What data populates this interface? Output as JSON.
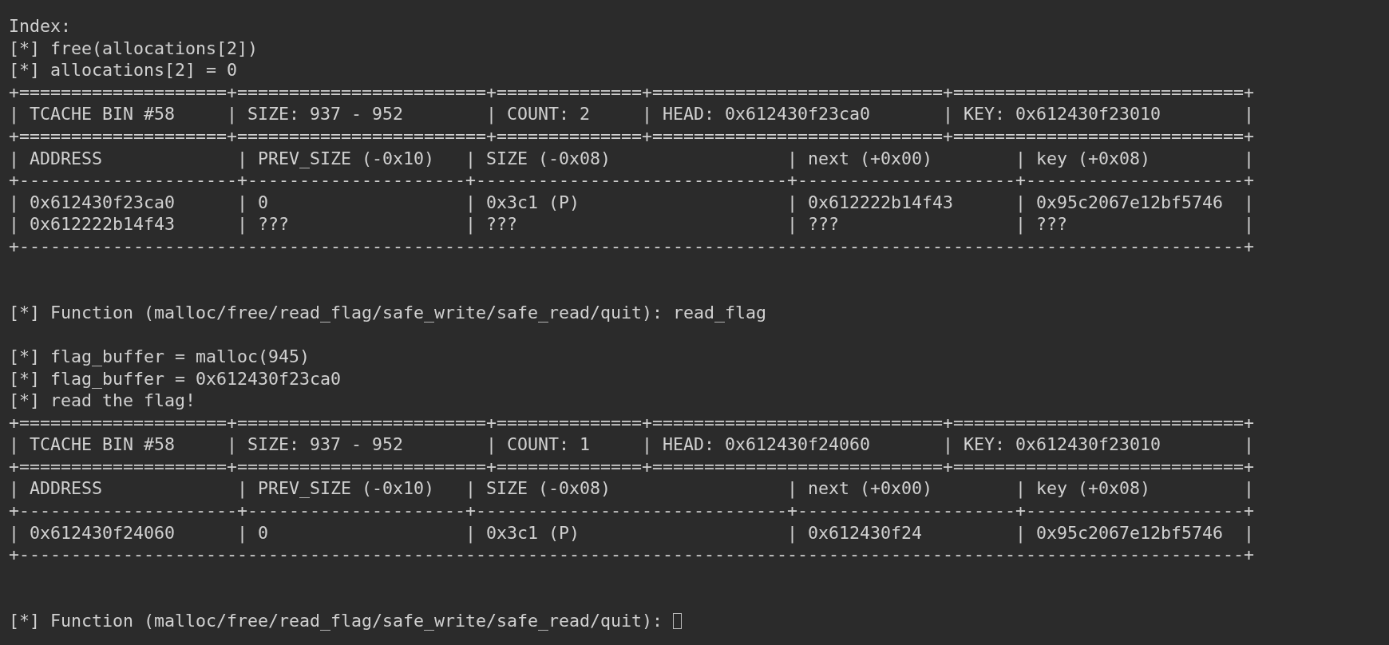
{
  "terminal": {
    "lines": [
      {
        "text": "Index:"
      },
      {
        "text": "[*] free(allocations[2])"
      },
      {
        "text": "[*] allocations[2] = 0"
      },
      {
        "text": "+====================+========================+==============+============================+============================+"
      },
      {
        "text": "| TCACHE BIN #58     | SIZE: 937 - 952        | COUNT: 2     | HEAD: 0x612430f23ca0       | KEY: 0x612430f23010        |"
      },
      {
        "text": "+====================+========================+==============+============================+============================+"
      },
      {
        "text": "| ADDRESS             | PREV_SIZE (-0x10)   | SIZE (-0x08)                 | next (+0x00)        | key (+0x08)         |"
      },
      {
        "text": "+---------------------+---------------------+------------------------------+---------------------+---------------------+"
      },
      {
        "text": "| 0x612430f23ca0      | 0                   | 0x3c1 (P)                    | 0x612222b14f43      | 0x95c2067e12bf5746  |"
      },
      {
        "text": "| 0x612222b14f43      | ???                 | ???                          | ???                 | ???                 |"
      },
      {
        "text": "+----------------------------------------------------------------------------------------------------------------------+"
      },
      {
        "kind": "blank"
      },
      {
        "kind": "blank"
      },
      {
        "text": "[*] Function (malloc/free/read_flag/safe_write/safe_read/quit): read_flag"
      },
      {
        "kind": "blank"
      },
      {
        "text": "[*] flag_buffer = malloc(945)"
      },
      {
        "text": "[*] flag_buffer = 0x612430f23ca0"
      },
      {
        "text": "[*] read the flag!"
      },
      {
        "text": "+====================+========================+==============+============================+============================+"
      },
      {
        "text": "| TCACHE BIN #58     | SIZE: 937 - 952        | COUNT: 1     | HEAD: 0x612430f24060       | KEY: 0x612430f23010        |"
      },
      {
        "text": "+====================+========================+==============+============================+============================+"
      },
      {
        "text": "| ADDRESS             | PREV_SIZE (-0x10)   | SIZE (-0x08)                 | next (+0x00)        | key (+0x08)         |"
      },
      {
        "text": "+---------------------+---------------------+------------------------------+---------------------+---------------------+"
      },
      {
        "text": "| 0x612430f24060      | 0                   | 0x3c1 (P)                    | 0x612430f24         | 0x95c2067e12bf5746  |"
      },
      {
        "text": "+----------------------------------------------------------------------------------------------------------------------+"
      },
      {
        "kind": "blank"
      },
      {
        "kind": "blank"
      },
      {
        "text": "[*] Function (malloc/free/read_flag/safe_write/safe_read/quit): ",
        "cursor": true
      }
    ]
  }
}
